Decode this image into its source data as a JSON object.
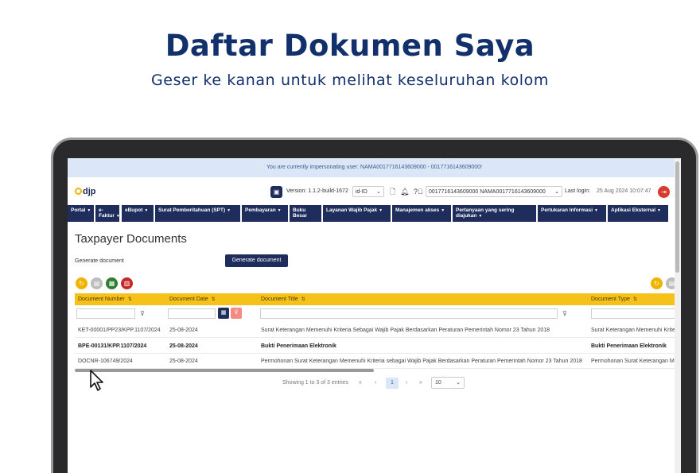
{
  "slide": {
    "title": "Daftar Dokumen Saya",
    "subtitle": "Geser ke kanan untuk melihat keseluruhan kolom"
  },
  "app": {
    "impersonation_banner": "You are currently impersonating user: NAMA0017716143609000 - 0017716143609000!",
    "logo_text": "djp",
    "version_label": "Version: 1.1.2-build-1672",
    "language": "id-ID",
    "user_selector": "0017716143609000 NAMA0017716143609000",
    "last_login_label": "Last login:",
    "last_login_value": "25 Aug 2024 10:07:47",
    "icons": {
      "copy": "copy-icon",
      "document": "document-icon",
      "bell": "bell-icon",
      "help": "help-icon",
      "logout": "logout-icon"
    }
  },
  "nav": [
    {
      "label": "Portal"
    },
    {
      "label": "e-Faktur"
    },
    {
      "label": "eBupot"
    },
    {
      "label": "Surat Pemberitahuan (SPT)"
    },
    {
      "label": "Pembayaran"
    },
    {
      "label": "Buku Besar"
    },
    {
      "label": "Layanan Wajib Pajak"
    },
    {
      "label": "Manajemen akses"
    },
    {
      "label": "Pertanyaan yang sering diajukan"
    },
    {
      "label": "Pertukaran Informasi"
    },
    {
      "label": "Aplikasi Eksternal"
    }
  ],
  "main": {
    "page_title": "Taxpayer Documents",
    "generate_label": "Generate document",
    "generate_button": "Generate document",
    "columns": [
      "Document Number",
      "Document Date",
      "Document Title",
      "Document Type"
    ],
    "rows": [
      {
        "number": "KET-00001/PP23/KPP.1107/2024",
        "date": "25-08-2024",
        "title": "Surat Keterangan Memenuhi Kriteria Sebagai Wajib Pajak Berdasarkan Peraturan Pemerintah Nomor 23 Tahun 2018",
        "type": "Surat Keterangan Memenuhi Kriteri"
      },
      {
        "number": "BPE-00131/KPP.1107/2024",
        "date": "25-08-2024",
        "title": "Bukti Penerimaan Elektronik",
        "type": "Bukti Penerimaan Elektronik"
      },
      {
        "number": "DOCNR-106749/2024",
        "date": "25-08-2024",
        "title": "Permohonan Surat Keterangan Memenuhi Kriteria sebagai Wajib Pajak Berdasarkan Peraturan Pemerintah Nomor 23 Tahun 2018",
        "type": "Permohonan Surat Keterangan Mem"
      }
    ],
    "pager": {
      "summary": "Showing 1 to 3 of 3 entries",
      "first": "«",
      "prev": "‹",
      "current": "1",
      "next": "›",
      "last": "»",
      "page_size": "10"
    }
  },
  "colors": {
    "navy": "#1e2d5c",
    "header_yellow": "#f6c21a",
    "banner_blue": "#dbe7f7",
    "title_blue": "#12306b"
  }
}
